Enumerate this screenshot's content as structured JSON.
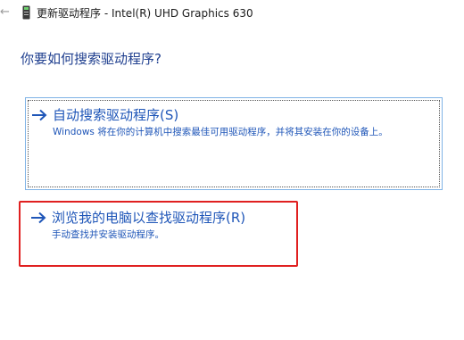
{
  "window": {
    "title": "更新驱动程序 - Intel(R) UHD Graphics 630",
    "back_glyph": "←",
    "device_icon": "graphics-device-icon"
  },
  "main": {
    "question": "你要如何搜索驱动程序?",
    "options": [
      {
        "title": "自动搜索驱动程序(S)",
        "description": "Windows 将在你的计算机中搜索最佳可用驱动程序，并将其安装在你的设备上。",
        "icon": "arrow-right-icon",
        "focused": true
      },
      {
        "title": "浏览我的电脑以查找驱动程序(R)",
        "description": "手动查找并安装驱动程序。",
        "icon": "arrow-right-icon",
        "highlighted": true
      }
    ]
  },
  "colors": {
    "link": "#1f56b8",
    "heading": "#1f3f8f",
    "focus_border": "#7fb3e6",
    "highlight": "#e02020"
  }
}
